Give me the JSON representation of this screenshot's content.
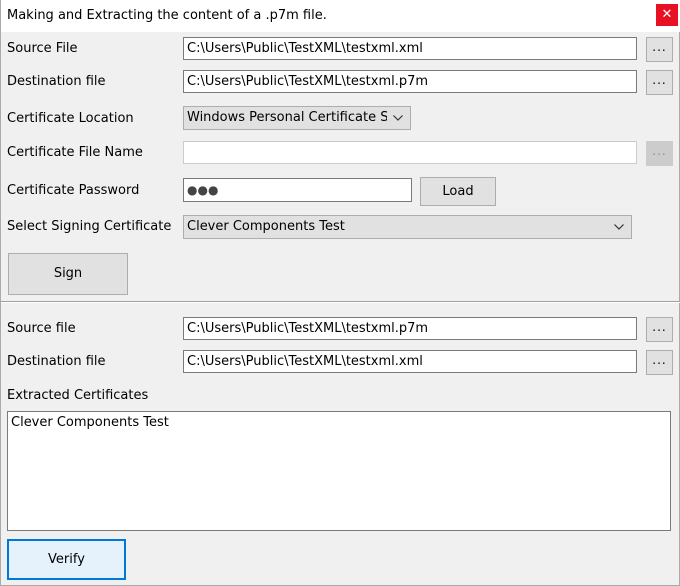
{
  "window": {
    "title": "Making and Extracting the content of a .p7m file.",
    "close_glyph": "✕"
  },
  "sign_section": {
    "source_file_label": "Source File",
    "source_file_value": "C:\\Users\\Public\\TestXML\\testxml.xml",
    "destination_file_label": "Destination file",
    "destination_file_value": "C:\\Users\\Public\\TestXML\\testxml.p7m",
    "browse_label": "...",
    "certificate_location_label": "Certificate Location",
    "certificate_location_value": "Windows Personal Certificate Sto",
    "certificate_file_name_label": "Certificate File Name",
    "certificate_file_name_value": "",
    "certificate_password_label": "Certificate Password",
    "certificate_password_value": "●●●",
    "load_button_label": "Load",
    "signing_certificate_label": "Select Signing Certificate",
    "signing_certificate_value": "Clever Components Test",
    "sign_button_label": "Sign"
  },
  "verify_section": {
    "source_file_label": "Source file",
    "source_file_value": "C:\\Users\\Public\\TestXML\\testxml.p7m",
    "destination_file_label": "Destination file",
    "destination_file_value": "C:\\Users\\Public\\TestXML\\testxml.xml",
    "browse_label": "...",
    "extracted_certificates_label": "Extracted Certificates",
    "extracted_certificates": [
      "Clever Components Test"
    ],
    "verify_button_label": "Verify"
  },
  "icons": {
    "close": "close-icon",
    "combo_arrow": "chevron-down-icon"
  },
  "colors": {
    "close_button": "#e81123",
    "focus_border": "#0078d7",
    "window_background": "#f0f0f0"
  }
}
